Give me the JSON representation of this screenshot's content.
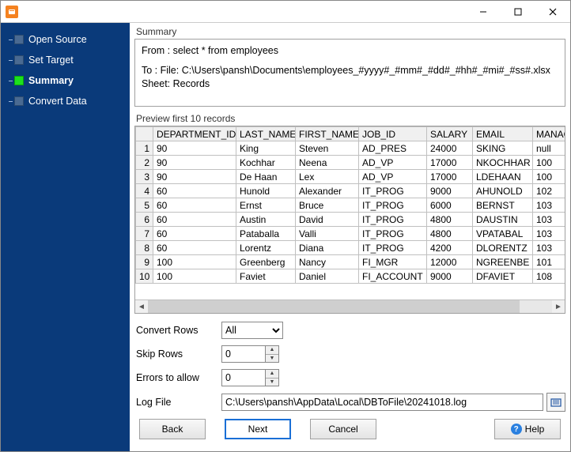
{
  "sidebar": {
    "items": [
      {
        "label": "Open Source",
        "active": false
      },
      {
        "label": "Set Target",
        "active": false
      },
      {
        "label": "Summary",
        "active": true
      },
      {
        "label": "Convert Data",
        "active": false
      }
    ]
  },
  "summary": {
    "title": "Summary",
    "from_line": "From : select * from employees",
    "to_line": "To : File: C:\\Users\\pansh\\Documents\\employees_#yyyy#_#mm#_#dd#_#hh#_#mi#_#ss#.xlsx Sheet: Records"
  },
  "preview": {
    "title": "Preview first 10 records",
    "columns": [
      "DEPARTMENT_ID",
      "LAST_NAME",
      "FIRST_NAME",
      "JOB_ID",
      "SALARY",
      "EMAIL",
      "MANAG"
    ],
    "rows": [
      [
        "90",
        "King",
        "Steven",
        "AD_PRES",
        "24000",
        "SKING",
        "null"
      ],
      [
        "90",
        "Kochhar",
        "Neena",
        "AD_VP",
        "17000",
        "NKOCHHAR",
        "100"
      ],
      [
        "90",
        "De Haan",
        "Lex",
        "AD_VP",
        "17000",
        "LDEHAAN",
        "100"
      ],
      [
        "60",
        "Hunold",
        "Alexander",
        "IT_PROG",
        "9000",
        "AHUNOLD",
        "102"
      ],
      [
        "60",
        "Ernst",
        "Bruce",
        "IT_PROG",
        "6000",
        "BERNST",
        "103"
      ],
      [
        "60",
        "Austin",
        "David",
        "IT_PROG",
        "4800",
        "DAUSTIN",
        "103"
      ],
      [
        "60",
        "Pataballa",
        "Valli",
        "IT_PROG",
        "4800",
        "VPATABAL",
        "103"
      ],
      [
        "60",
        "Lorentz",
        "Diana",
        "IT_PROG",
        "4200",
        "DLORENTZ",
        "103"
      ],
      [
        "100",
        "Greenberg",
        "Nancy",
        "FI_MGR",
        "12000",
        "NGREENBE",
        "101"
      ],
      [
        "100",
        "Faviet",
        "Daniel",
        "FI_ACCOUNT",
        "9000",
        "DFAVIET",
        "108"
      ]
    ]
  },
  "form": {
    "convert_rows_label": "Convert Rows",
    "convert_rows_value": "All",
    "skip_rows_label": "Skip Rows",
    "skip_rows_value": "0",
    "errors_label": "Errors to allow",
    "errors_value": "0",
    "log_label": "Log File",
    "log_value": "C:\\Users\\pansh\\AppData\\Local\\DBToFile\\20241018.log"
  },
  "footer": {
    "back": "Back",
    "next": "Next",
    "cancel": "Cancel",
    "help": "Help"
  }
}
